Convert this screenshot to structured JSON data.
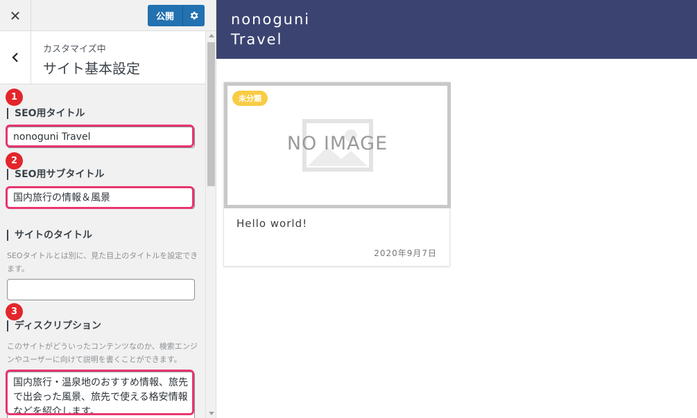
{
  "topbar": {
    "close_label": "✕",
    "publish_label": "公開"
  },
  "section": {
    "customizing_label": "カスタマイズ中",
    "title": "サイト基本設定"
  },
  "fields": {
    "seo_title": {
      "badge": "1",
      "label": "SEO用タイトル",
      "value": "nonoguni Travel"
    },
    "seo_subtitle": {
      "badge": "2",
      "label": "SEO用サブタイトル",
      "value": "国内旅行の情報＆風景"
    },
    "site_title": {
      "label": "サイトのタイトル",
      "description": "SEOタイトルとは別に、見た目上のタイトルを設定できます。",
      "value": ""
    },
    "description": {
      "badge": "3",
      "label": "ディスクリプション",
      "description": "このサイトがどういったコンテンツなのか、検索エンジンやユーザーに向けて説明を書くことができます。",
      "value": "国内旅行・温泉地のおすすめ情報、旅先で出会った風景、旅先で使える格安情報などを紹介します。"
    }
  },
  "preview": {
    "site_title_line1": "nonoguni",
    "site_title_line2": "Travel",
    "post": {
      "category": "未分類",
      "noimage": "NO IMAGE",
      "title": "Hello world!",
      "date": "2020年9月7日"
    }
  },
  "colors": {
    "header_bg": "#3b4471",
    "publish_blue": "#2271b1",
    "highlight": "#e8356d",
    "badge_red": "#e3262b",
    "category_yellow": "#f8cc44"
  },
  "icons": {
    "close": "close-icon",
    "gear": "gear-icon",
    "back": "chevron-left-icon",
    "image": "image-placeholder-icon"
  }
}
